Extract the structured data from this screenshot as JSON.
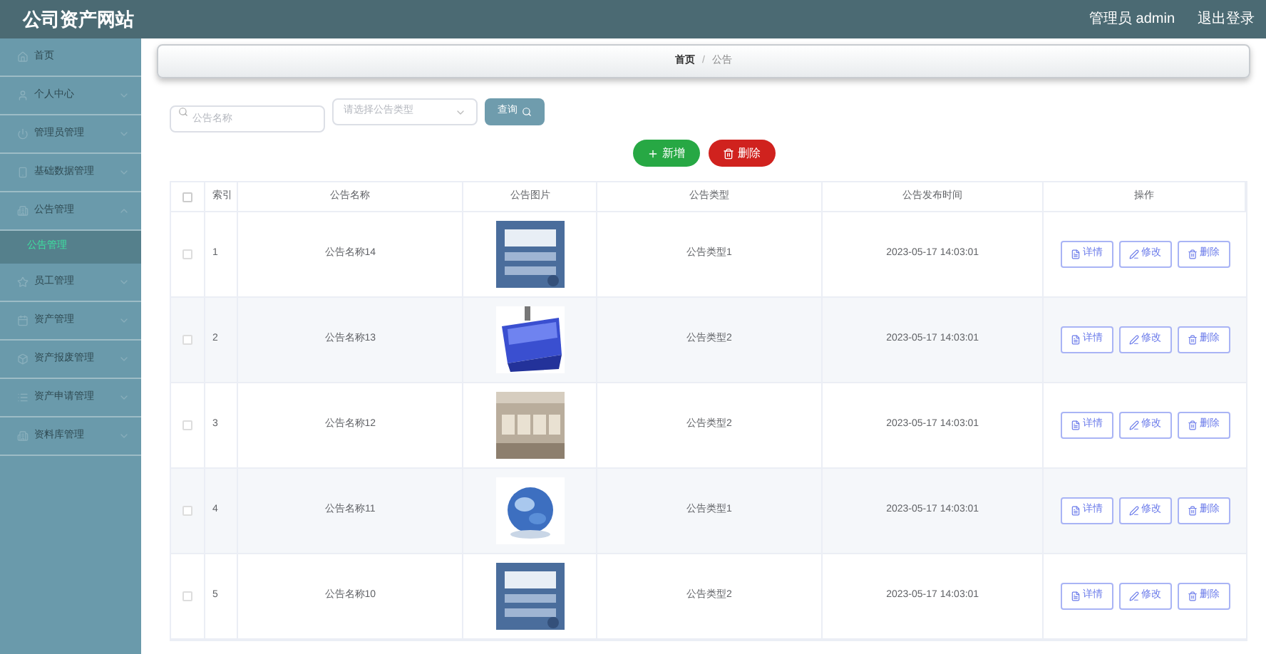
{
  "header": {
    "title": "公司资产网站",
    "user": "管理员 admin",
    "logout": "退出登录"
  },
  "sidebar": {
    "items": [
      {
        "label": "首页",
        "kind": "link",
        "selected": false
      },
      {
        "label": "个人中心",
        "kind": "group",
        "expanded": false
      },
      {
        "label": "管理员管理",
        "kind": "group",
        "expanded": false
      },
      {
        "label": "基础数据管理",
        "kind": "group",
        "expanded": false
      },
      {
        "label": "公告管理",
        "kind": "group",
        "expanded": true,
        "children": [
          {
            "label": "公告管理",
            "selected": true
          }
        ]
      },
      {
        "label": "员工管理",
        "kind": "group",
        "expanded": false
      },
      {
        "label": "资产管理",
        "kind": "group",
        "expanded": false
      },
      {
        "label": "资产报废管理",
        "kind": "group",
        "expanded": false
      },
      {
        "label": "资产申请管理",
        "kind": "group",
        "expanded": false
      },
      {
        "label": "资料库管理",
        "kind": "group",
        "expanded": false
      }
    ]
  },
  "breadcrumb": {
    "items": [
      "首页",
      "公告"
    ],
    "separator": "/"
  },
  "search": {
    "name_placeholder": "公告名称",
    "type_placeholder": "请选择公告类型",
    "button": "查询"
  },
  "actions": {
    "add": "新增",
    "delete": "删除"
  },
  "table": {
    "select_all_checked": false,
    "columns": [
      "索引",
      "公告名称",
      "公告图片",
      "公告类型",
      "公告发布时间",
      "操作"
    ],
    "rows": [
      {
        "index": "1",
        "name": "公告名称14",
        "type": "公告类型1",
        "time": "2023-05-17 14:03:01",
        "checked": false,
        "actions": [
          "详情",
          "修改",
          "删除"
        ]
      },
      {
        "index": "2",
        "name": "公告名称13",
        "type": "公告类型2",
        "time": "2023-05-17 14:03:01",
        "checked": false,
        "actions": [
          "详情",
          "修改",
          "删除"
        ]
      },
      {
        "index": "3",
        "name": "公告名称12",
        "type": "公告类型2",
        "time": "2023-05-17 14:03:01",
        "checked": false,
        "actions": [
          "详情",
          "修改",
          "删除"
        ]
      },
      {
        "index": "4",
        "name": "公告名称11",
        "type": "公告类型1",
        "time": "2023-05-17 14:03:01",
        "checked": false,
        "actions": [
          "详情",
          "修改",
          "删除"
        ]
      },
      {
        "index": "5",
        "name": "公告名称10",
        "type": "公告类型2",
        "time": "2023-05-17 14:03:01",
        "checked": false,
        "actions": [
          "详情",
          "修改",
          "删除"
        ]
      }
    ]
  }
}
